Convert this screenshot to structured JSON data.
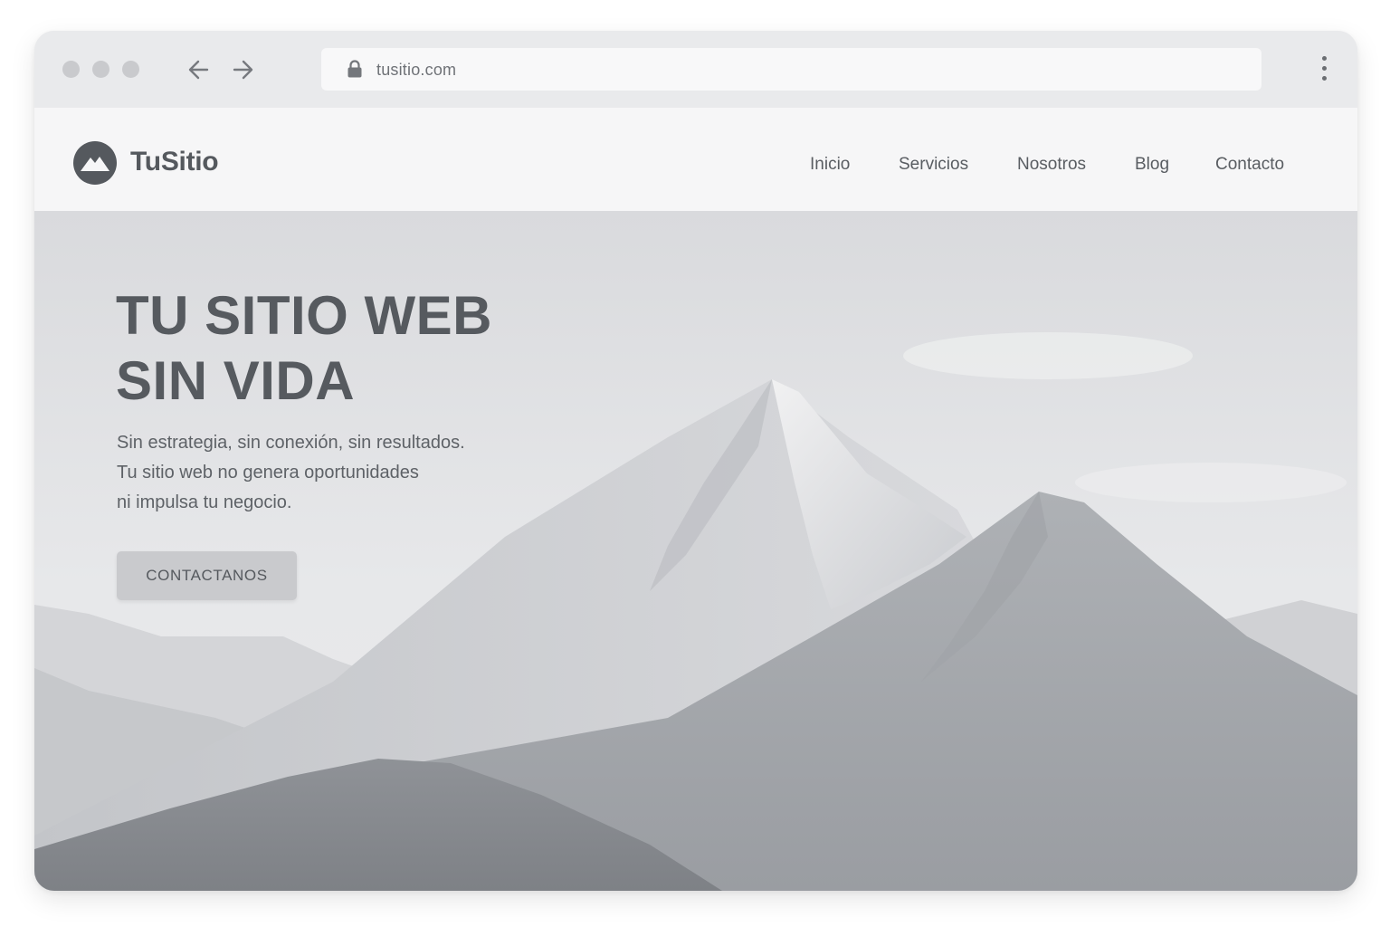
{
  "browser": {
    "url": "tusitio.com",
    "icons": [
      "window-dot",
      "back-arrow-icon",
      "forward-arrow-icon",
      "lock-icon",
      "more-vertical-icon"
    ]
  },
  "site": {
    "logo_text": "TuSitio",
    "logo_icon": "mountain-logo-icon",
    "nav": [
      "Inicio",
      "Servicios",
      "Nosotros",
      "Blog",
      "Contacto"
    ]
  },
  "hero": {
    "title_lines": [
      "TU SITIO WEB",
      "SIN VIDA"
    ],
    "subtitle_lines": [
      "Sin estrategia, sin conexión, sin resultados.",
      "Tu sitio web no genera oportunidades",
      "ni impulsa tu negocio."
    ],
    "cta_label": "CONTACTANOS"
  },
  "colors": {
    "text_dark": "#565a5f",
    "chrome_bg": "#e9eaec",
    "header_bg": "#f6f6f7",
    "button_bg": "#c9cacd"
  }
}
